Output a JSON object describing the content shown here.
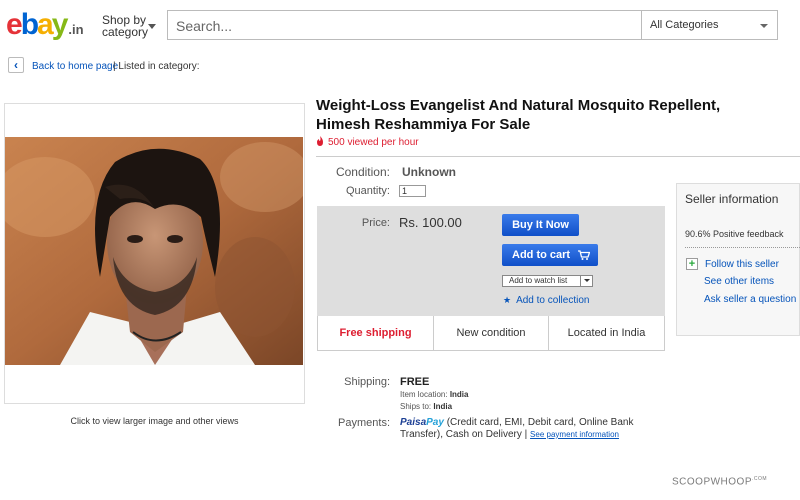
{
  "header": {
    "logo_letters": [
      "e",
      "b",
      "a",
      "y"
    ],
    "logo_suffix": ".in",
    "shop_by": "Shop by",
    "shop_by_2": "category",
    "search_placeholder": "Search...",
    "categories_label": "All Categories"
  },
  "breadcrumb": {
    "back_label": "Back to home page",
    "listed_label": "| Listed in category:"
  },
  "image": {
    "caption": "Click to view larger image and other views"
  },
  "listing": {
    "title": "Weight-Loss Evangelist And Natural Mosquito Repellent, Himesh Reshammiya For Sale",
    "viewed": "500 viewed per hour",
    "condition_label": "Condition:",
    "condition_value": "Unknown",
    "quantity_label": "Quantity:",
    "quantity_value": "1",
    "price_label": "Price:",
    "price_value": "Rs. 100.00",
    "buy_now": "Buy It Now",
    "add_to_cart": "Add to cart",
    "watch_list": "Add to watch list",
    "add_collection": "Add to collection",
    "features": [
      "Free shipping",
      "New condition",
      "Located in India"
    ]
  },
  "seller": {
    "title": "Seller information",
    "feedback": "90.6% Positive feedback",
    "follow": "Follow this seller",
    "other_items": "See other items",
    "ask": "Ask seller a question"
  },
  "shipping": {
    "label": "Shipping:",
    "value": "FREE",
    "item_location_label": "Item location:",
    "item_location": "India",
    "ships_to_label": "Ships to:",
    "ships_to": "India"
  },
  "payments": {
    "label": "Payments:",
    "paisa": "Paisa",
    "pay": "Pay",
    "methods": "(Credit card, EMI, Debit card, Online Bank Transfer),  Cash on Delivery  |",
    "see_info": "See payment information"
  },
  "watermark": "SCOOPWHOOP",
  "watermark_sup": ".COM",
  "colors": {
    "ebay_red": "#e53238",
    "ebay_blue": "#0064d2",
    "ebay_yellow": "#f5af02",
    "ebay_green": "#86b817",
    "link_blue": "#0654ba",
    "button_blue": "#0f4fc8",
    "alert_red": "#dd1e31"
  }
}
